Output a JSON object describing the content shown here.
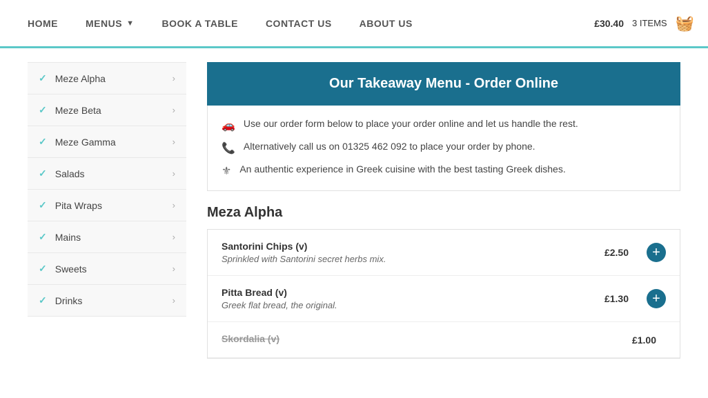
{
  "nav": {
    "links": [
      {
        "label": "HOME",
        "id": "home",
        "dropdown": false
      },
      {
        "label": "MENUS",
        "id": "menus",
        "dropdown": true
      },
      {
        "label": "BOOK A TABLE",
        "id": "book-a-table",
        "dropdown": false
      },
      {
        "label": "CONTACT US",
        "id": "contact-us",
        "dropdown": false
      },
      {
        "label": "ABOUT US",
        "id": "about-us",
        "dropdown": false
      }
    ],
    "cart_price": "£30.40",
    "cart_items": "3 ITEMS"
  },
  "sidebar": {
    "items": [
      {
        "label": "Meze Alpha",
        "id": "meze-alpha"
      },
      {
        "label": "Meze Beta",
        "id": "meze-beta"
      },
      {
        "label": "Meze Gamma",
        "id": "meze-gamma"
      },
      {
        "label": "Salads",
        "id": "salads"
      },
      {
        "label": "Pita Wraps",
        "id": "pita-wraps"
      },
      {
        "label": "Mains",
        "id": "mains"
      },
      {
        "label": "Sweets",
        "id": "sweets"
      },
      {
        "label": "Drinks",
        "id": "drinks"
      }
    ]
  },
  "main": {
    "header": "Our Takeaway Menu - Order Online",
    "info_lines": [
      {
        "icon": "🚗",
        "text": "Use our order form below to place your order online and let us handle the rest."
      },
      {
        "icon": "📞",
        "text": "Alternatively call us on 01325 462 092 to place your order by phone."
      },
      {
        "icon": "⚜",
        "text": "An authentic experience in Greek cuisine with the best tasting Greek dishes."
      }
    ],
    "section_title": "Meza Alpha",
    "menu_items": [
      {
        "name": "Santorini Chips (v)",
        "desc": "Sprinkled with Santorini secret herbs mix.",
        "price": "£2.50",
        "strikethrough": false
      },
      {
        "name": "Pitta Bread (v)",
        "desc": "Greek flat bread, the original.",
        "price": "£1.30",
        "strikethrough": false
      },
      {
        "name": "Skordalia (v)",
        "desc": "",
        "price": "£1.00",
        "strikethrough": true
      }
    ]
  }
}
